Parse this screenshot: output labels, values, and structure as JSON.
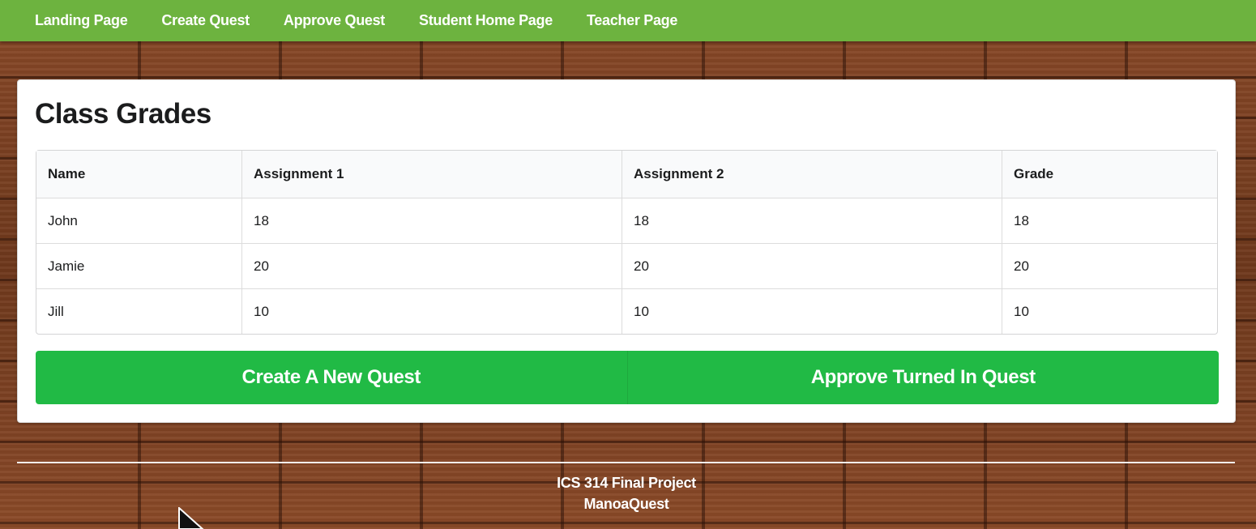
{
  "nav": {
    "items": [
      {
        "label": "Landing Page"
      },
      {
        "label": "Create Quest"
      },
      {
        "label": "Approve Quest"
      },
      {
        "label": "Student Home Page"
      },
      {
        "label": "Teacher Page"
      }
    ]
  },
  "main": {
    "title": "Class Grades",
    "table": {
      "headers": [
        "Name",
        "Assignment 1",
        "Assignment 2",
        "Grade"
      ],
      "rows": [
        [
          "John",
          "18",
          "18",
          "18"
        ],
        [
          "Jamie",
          "20",
          "20",
          "20"
        ],
        [
          "Jill",
          "10",
          "10",
          "10"
        ]
      ]
    },
    "buttons": {
      "create_label": "Create A New Quest",
      "approve_label": "Approve Turned In Quest"
    }
  },
  "footer": {
    "line1": "ICS 314 Final Project",
    "line2": "ManoaQuest"
  },
  "colors": {
    "nav_background": "#6db33f",
    "button_green": "#21ba45",
    "card_background": "#ffffff"
  }
}
